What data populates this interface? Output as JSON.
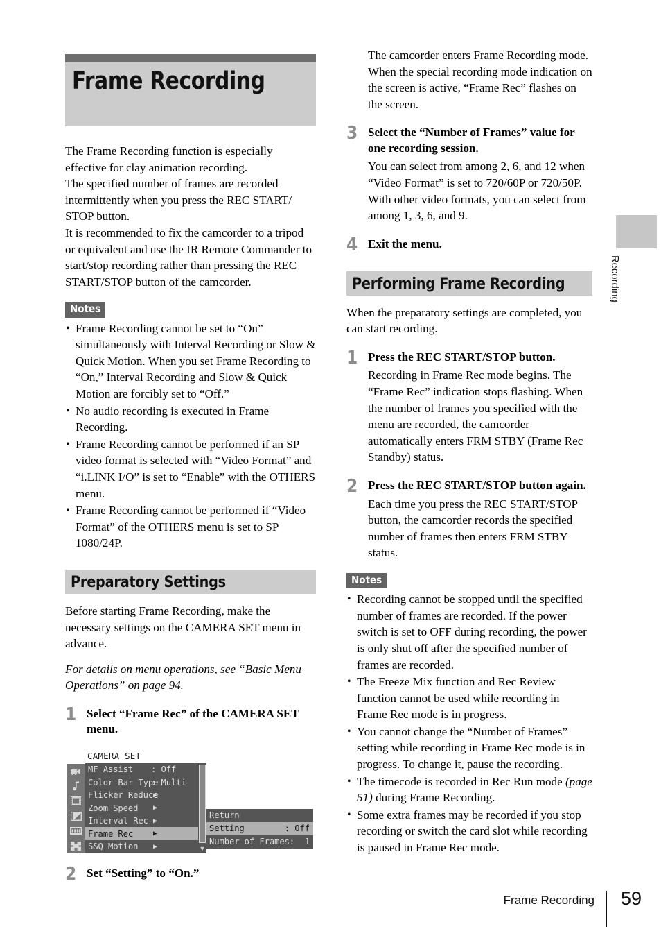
{
  "chapter": {
    "title": "Frame Recording"
  },
  "left": {
    "intro_paragraphs": [
      "The Frame Recording function is especially effective for clay animation recording.",
      "The specified number of frames are recorded intermittently when you press the REC START/ STOP button.",
      "It is recommended to fix the camcorder to a tripod or equivalent and use the IR Remote Commander to start/stop recording rather than pressing the REC START/STOP button of the camcorder."
    ],
    "notes_label": "Notes",
    "notes": [
      "Frame Recording cannot be set to “On” simultaneously with Interval Recording or Slow & Quick Motion. When you set Frame Recording to “On,” Interval Recording and Slow & Quick Motion are forcibly set to “Off.”",
      "No audio recording is executed in Frame Recording.",
      "Frame Recording cannot be performed if an SP video format is selected with “Video Format” and “i.LINK I/O” is set to “Enable” with the OTHERS menu.",
      "Frame Recording cannot be performed if “Video Format” of the OTHERS menu is set to SP 1080/24P."
    ],
    "section_head": "Preparatory Settings",
    "section_intro": "Before starting Frame Recording, make the necessary settings on the CAMERA SET menu in advance.",
    "section_note_italic": "For details on menu operations, see “Basic Menu Operations” on page 94.",
    "step1_num": "1",
    "step1_title": "Select “Frame Rec” of the CAMERA SET menu.",
    "step2_num": "2",
    "step2_title": "Set “Setting” to “On.”"
  },
  "menu_screenshot": {
    "title": "CAMERA SET",
    "icons": [
      "camcorder-icon",
      "audio-note-icon",
      "video-film-icon",
      "lcd-monitor-icon",
      "display-panel-icon",
      "others-grid-icon"
    ],
    "rows": [
      {
        "label": "MF Assist",
        "value": ": Off",
        "arrow": "",
        "selected": false
      },
      {
        "label": "Color Bar Type",
        "value": ": Multi",
        "arrow": "",
        "selected": false
      },
      {
        "label": "Flicker Reduce",
        "value": "",
        "arrow": "▶",
        "selected": false
      },
      {
        "label": "Zoom Speed",
        "value": "",
        "arrow": "▶",
        "selected": false
      },
      {
        "label": "Interval Rec",
        "value": "",
        "arrow": "▶",
        "selected": false
      },
      {
        "label": "Frame Rec",
        "value": "",
        "arrow": "▶",
        "selected": true
      },
      {
        "label": "S&Q Motion",
        "value": "",
        "arrow": "▶",
        "selected": false
      }
    ],
    "scroll_down_arrow": "▼",
    "submenu": [
      {
        "label": "Return",
        "value": "",
        "selected": false
      },
      {
        "label": "Setting",
        "value": ": Off",
        "selected": true
      },
      {
        "label": "Number of Frames:",
        "value": "1",
        "selected": false
      }
    ]
  },
  "right": {
    "continued_paragraphs": [
      "The camcorder enters Frame Recording mode.",
      "When the special recording mode indication on the screen is active, “Frame Rec” flashes on the screen."
    ],
    "step3_num": "3",
    "step3_title": "Select the “Number of Frames” value for one recording session.",
    "step3_desc": "You can select from among 2, 6, and 12 when “Video Format” is set to 720/60P or 720/50P. With other video formats, you can select from among 1, 3, 6, and 9.",
    "step4_num": "4",
    "step4_title": "Exit the menu.",
    "section_head": "Performing Frame Recording",
    "section_intro": "When the preparatory settings are completed, you can start recording.",
    "step1_num": "1",
    "step1_title": "Press the REC START/STOP button.",
    "step1_desc": "Recording in Frame Rec mode begins. The “Frame Rec” indication stops flashing. When the number of frames you specified with the menu are recorded, the camcorder automatically enters FRM STBY (Frame Rec Standby) status.",
    "step2_num": "2",
    "step2_title": "Press the REC START/STOP button again.",
    "step2_desc": "Each time you press the REC START/STOP button, the camcorder records the specified number of frames then enters FRM STBY status.",
    "notes_label": "Notes",
    "notes": [
      "Recording cannot be stopped until the specified number of frames are recorded. If the power switch is set to OFF during recording, the power is only shut off after the specified number of frames are recorded.",
      "The Freeze Mix function and Rec Review function cannot be used while recording in Frame Rec mode is in progress.",
      "You cannot change the “Number of Frames” setting while recording in Frame Rec mode is in progress. To change it, pause the recording.",
      "The timecode is recorded in Rec Run mode (page 51) during Frame Recording.",
      "Some extra frames may be recorded if you stop recording or switch the card slot while recording is paused in Frame Rec mode."
    ]
  },
  "side_tab": {
    "label": "Recording"
  },
  "footer": {
    "title": "Frame Recording",
    "page": "59"
  },
  "colors": {
    "title_bar_top": "#6e6e6e",
    "title_bar_body": "#cccccc",
    "section_head_bg": "#cccccc",
    "notes_label_bg": "#636363",
    "step_number": "#8c8c8c",
    "menu_bg": "#555555",
    "menu_selected": "#b0b0b0",
    "side_tab": "#c6c6c6"
  }
}
